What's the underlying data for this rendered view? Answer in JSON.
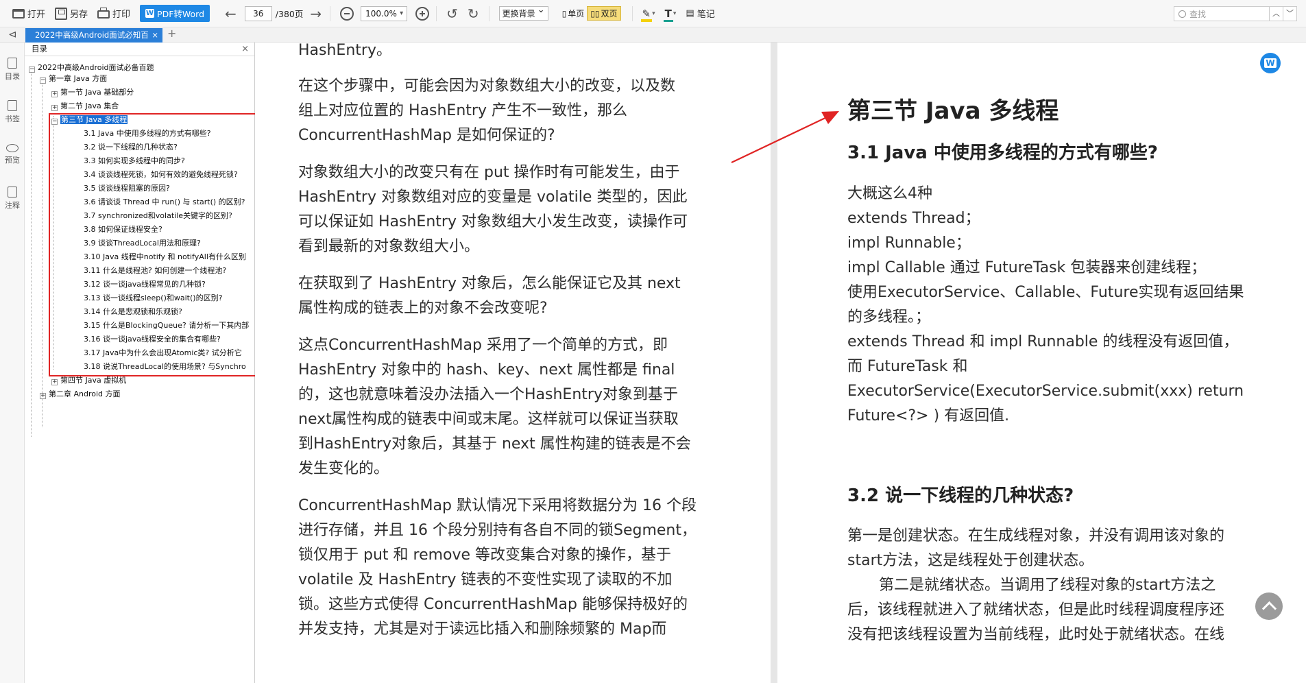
{
  "toolbar": {
    "open": "打开",
    "save_as": "另存",
    "print": "打印",
    "pdf_to_word": "PDF转Word",
    "page_current": "36",
    "page_total": "/380页",
    "zoom": "100.0%",
    "background": "更换背景",
    "single_page": "单页",
    "double_page": "双页",
    "notes": "笔记",
    "search_placeholder": "查找"
  },
  "tab": {
    "title": "2022中高级Android面试必知百",
    "close": "×",
    "add": "+"
  },
  "rail": {
    "items": [
      "目录",
      "书签",
      "预览",
      "注释"
    ]
  },
  "outline": {
    "title": "目录",
    "close": "×",
    "items": [
      "2022中高级Android面试必备百题",
      "第一章 Java 方面",
      "第一节 Java 基础部分",
      "第二节 Java 集合",
      "第三节 Java 多线程",
      "3.1 Java 中使用多线程的方式有哪些?",
      "3.2 说一下线程的几种状态?",
      "3.3 如何实现多线程中的同步?",
      "3.4 谈谈线程死锁，如何有效的避免线程死锁?",
      "3.5 谈谈线程阻塞的原因?",
      "3.6 请谈谈 Thread 中 run() 与 start() 的区别?",
      "3.7 synchronized和volatile关键字的区别?",
      "3.8 如何保证线程安全?",
      "3.9 谈谈ThreadLocal用法和原理?",
      "3.10 Java 线程中notify 和 notifyAll有什么区别",
      "3.11 什么是线程池? 如何创建一个线程池?",
      "3.12 谈一谈java线程常见的几种锁?",
      "3.13 谈一谈线程sleep()和wait()的区别?",
      "3.14 什么是悲观锁和乐观锁?",
      "3.15 什么是BlockingQueue? 请分析一下其内部",
      "3.16 谈一谈java线程安全的集合有哪些?",
      "3.17 Java中为什么会出现Atomic类? 试分析它",
      "3.18 说说ThreadLocal的使用场景? 与Synchro",
      "第四节 Java 虚拟机",
      "第二章 Android 方面"
    ]
  },
  "left_page": {
    "paragraphs": [
      [
        "HashEntry。"
      ],
      [
        "在这个步骤中，可能会因为对象数组大小的改变，以及数",
        "组上对应位置的 HashEntry 产生不一致性，那么",
        "ConcurrentHashMap 是如何保证的?"
      ],
      [
        "对象数组大小的改变只有在 put 操作时有可能发生，由于",
        "HashEntry 对象数组对应的变量是 volatile 类型的，因此",
        "可以保证如 HashEntry 对象数组大小发生改变，读操作可",
        "看到最新的对象数组大小。"
      ],
      [
        "在获取到了 HashEntry 对象后，怎么能保证它及其 next",
        "属性构成的链表上的对象不会改变呢?"
      ],
      [
        "这点ConcurrentHashMap 采用了一个简单的方式，即",
        "HashEntry 对象中的 hash、key、next 属性都是 final",
        "的，这也就意味着没办法插入一个HashEntry对象到基于",
        "next属性构成的链表中间或末尾。这样就可以保证当获取",
        "到HashEntry对象后，其基于 next 属性构建的链表是不会",
        "发生变化的。"
      ],
      [
        "ConcurrentHashMap 默认情况下采用将数据分为 16 个段",
        "进行存储，并且 16 个段分别持有各自不同的锁Segment，",
        "锁仅用于 put 和 remove 等改变集合对象的操作，基于",
        "volatile 及 HashEntry 链表的不变性实现了读取的不加",
        "锁。这些方式使得 ConcurrentHashMap 能够保持极好的",
        "并发支持，尤其是对于读远比插入和删除频繁的 Map而"
      ]
    ]
  },
  "right_page": {
    "section_title": "第三节 Java 多线程",
    "q1_title": "3.1 Java 中使用多线程的方式有哪些?",
    "q1_lines": [
      "大概这么4种",
      "extends Thread；",
      "impl Runnable；",
      "impl Callable 通过 FutureTask 包装器来创建线程；",
      "使用ExecutorService、Callable、Future实现有返回结果",
      "的多线程。；",
      "extends Thread 和 impl Runnable 的线程没有返回值，",
      "而 FutureTask 和",
      "ExecutorService(ExecutorService.submit(xxx) return",
      "Future<?> ) 有返回值."
    ],
    "q2_title": "3.2 说一下线程的几种状态?",
    "q2_lines": [
      "第一是创建状态。在生成线程对象，并没有调用该对象的",
      "start方法，这是线程处于创建状态。",
      "第二是就绪状态。当调用了线程对象的start方法之",
      "后，该线程就进入了就绪状态，但是此时线程调度程序还",
      "没有把该线程设置为当前线程，此时处于就绪状态。在线"
    ]
  },
  "colors": {
    "accent": "#2b7fd8",
    "selection": "#1a6fd4",
    "annotation_red": "#e02424"
  }
}
